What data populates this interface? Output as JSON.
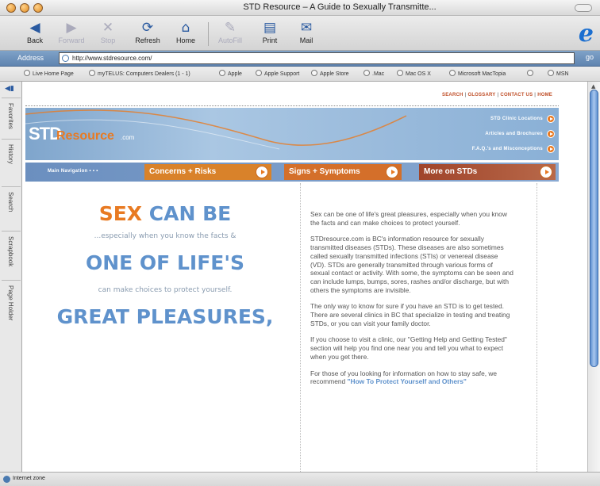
{
  "window": {
    "title": "STD Resource – A Guide to Sexually Transmitte..."
  },
  "toolbar": {
    "back": "Back",
    "forward": "Forward",
    "stop": "Stop",
    "refresh": "Refresh",
    "home": "Home",
    "autofill": "AutoFill",
    "print": "Print",
    "mail": "Mail"
  },
  "address": {
    "label": "Address",
    "url": "http://www.stdresource.com/",
    "go": "go"
  },
  "favorites": [
    "Live Home Page",
    "myTELUS: Computers Dealers (1 - 1)",
    "Apple",
    "Apple Support",
    "Apple Store",
    ".Mac",
    "Mac OS X",
    "Microsoft MacTopia",
    "",
    "MSN"
  ],
  "sidebar_tabs": [
    "Favorites",
    "History",
    "Search",
    "Scrapbook",
    "Page Holder"
  ],
  "status": "Internet zone",
  "site": {
    "topnav": [
      "SEARCH",
      "GLOSSARY",
      "CONTACT US",
      "HOME"
    ],
    "logo": {
      "std": "STD",
      "resource": "Resource",
      "com": ".com"
    },
    "banner_links": [
      "STD Clinic Locations",
      "Articles and Brochures",
      "F.A.Q.'s and Misconceptions"
    ],
    "nav_label": "Main Navigation",
    "nav_arrows": "• • •",
    "nav_buttons": [
      "Concerns + Risks",
      "Signs + Symptoms",
      "More on STDs"
    ],
    "hero": {
      "line1a": "SEX",
      "line1b": "CAN BE",
      "line2": "...especially when you know the facts &",
      "line3": "ONE OF LIFE'S",
      "line4": "can make choices to protect yourself.",
      "line5": "GREAT PLEASURES,"
    },
    "paragraphs": [
      "Sex can be one of life's great pleasures, especially when you know the facts and can make choices to protect yourself.",
      "STDresource.com is BC's information resource for sexually transmitted diseases (STDs). These diseases are also sometimes called sexually transmitted infections (STIs) or venereal disease (VD). STDs are generally transmitted through various forms of sexual contact or activity. With some, the symptoms can be seen and can include lumps, bumps, sores, rashes and/or discharge, but with others the symptoms are invisible.",
      "The only way to know for sure if you have an STD is to get tested. There are several clinics in BC that specialize in testing and treating STDs, or you can visit your family doctor.",
      "If you choose to visit a clinic, our \"Getting Help and Getting Tested\" section will help you find one near you and tell you what to expect when you get there."
    ],
    "last_paragraph_text": "For those of you looking for information on how to stay safe, we recommend ",
    "last_paragraph_link": "\"How To Protect Yourself and Others\""
  },
  "colors": {
    "accent_orange": "#e87a22",
    "accent_blue": "#5f92cc",
    "nav_concerns": "#d9822a",
    "nav_signs": "#d46f2a",
    "nav_more": "#a0442a"
  }
}
